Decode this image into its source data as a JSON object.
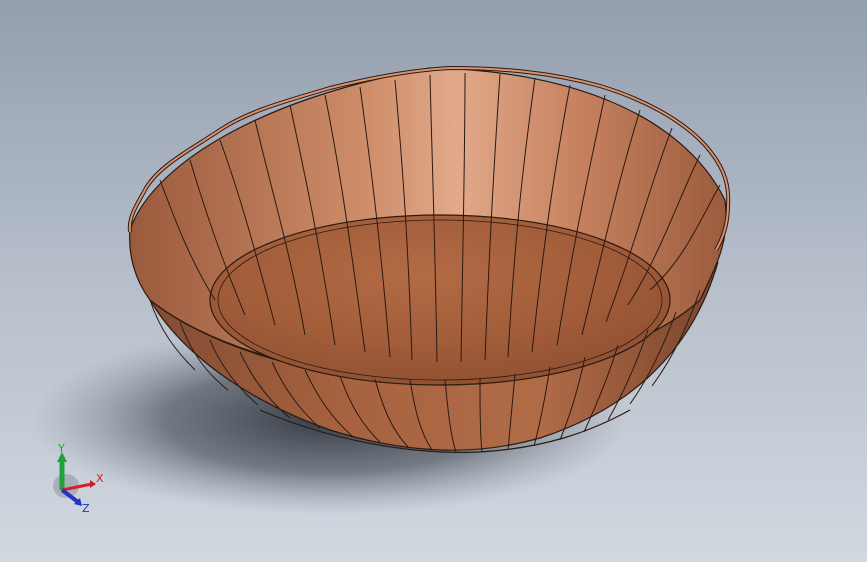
{
  "viewport": {
    "background_top": "#939eae",
    "background_bottom": "#d2d8e0"
  },
  "model": {
    "kind": "fluted bowl",
    "color": "#b86e4a",
    "edge_color": "#2a1a12"
  },
  "triad": {
    "x_label": "X",
    "y_label": "Y",
    "z_label": "Z",
    "x_color": "#d0202a",
    "y_color": "#1da33a",
    "z_color": "#2233c8"
  }
}
